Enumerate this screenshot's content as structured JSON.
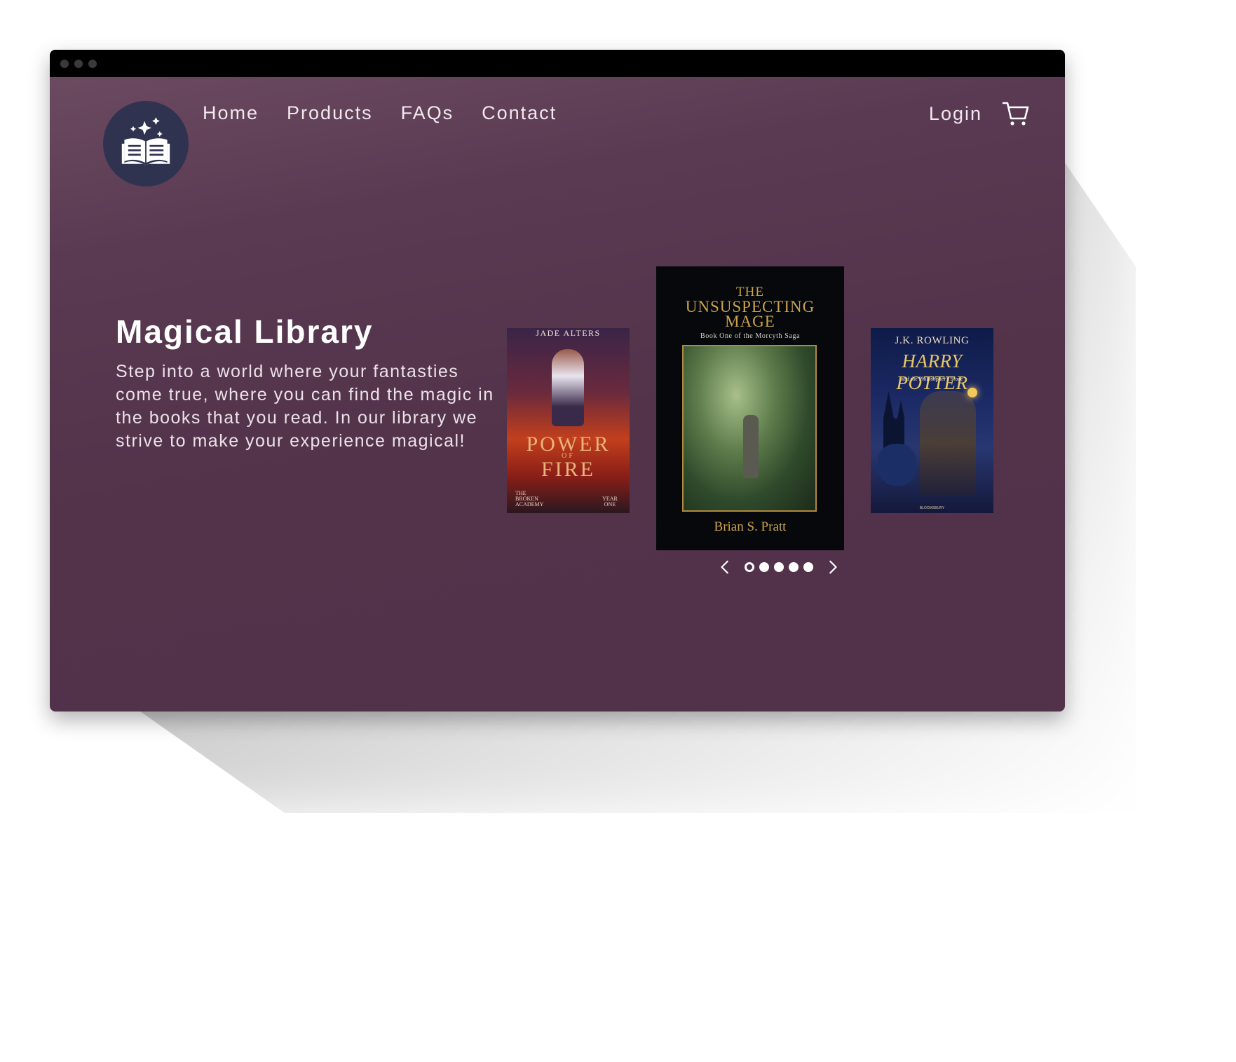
{
  "nav": {
    "links": [
      "Home",
      "Products",
      "FAQs",
      "Contact"
    ],
    "login": "Login"
  },
  "icons": {
    "logo": "book-stars-icon",
    "cart": "cart-icon",
    "prev": "chevron-left-icon",
    "next": "chevron-right-icon"
  },
  "hero": {
    "title": "Magical Library",
    "description": "Step into a world where your fantasties come true, where you can find the magic in the books that you read. In our library we strive to make your experience magical!"
  },
  "carousel": {
    "books": [
      {
        "author": "JADE ALTERS",
        "title_lines": [
          "POWER",
          "FIRE"
        ],
        "title_joiner": "OF",
        "series": "THE BROKEN ACADEMY",
        "year": "YEAR ONE"
      },
      {
        "title_lines": [
          "THE",
          "UNSUSPECTING",
          "MAGE"
        ],
        "subtitle": "Book One of the Morcyth Saga",
        "author": "Brian S. Pratt"
      },
      {
        "author": "J.K. ROWLING",
        "title": "HARRY POTTER",
        "subtitle": "and the Philosopher's Stone",
        "publisher": "BLOOMSBURY"
      }
    ],
    "dots": 5,
    "active_dot": 1
  },
  "colors": {
    "background_top": "#6e4d63",
    "background": "#53334a",
    "logo_bg": "#2f3350",
    "text": "#ffffff"
  }
}
